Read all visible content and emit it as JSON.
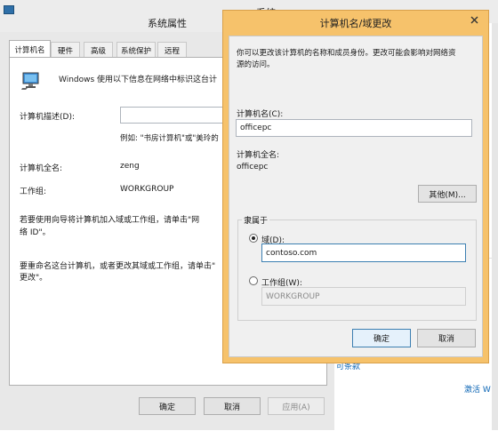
{
  "bg_window": {
    "title": "系统属性",
    "title_fragment": "系统",
    "tabs": [
      {
        "label": "计算机名"
      },
      {
        "label": "硬件"
      },
      {
        "label": "高级"
      },
      {
        "label": "系统保护"
      },
      {
        "label": "远程"
      }
    ],
    "intro": "Windows 使用以下信息在网络中标识这台计",
    "description_label": "计算机描述(D):",
    "description_value": "",
    "example": "例如: \"书房计算机\"或\"美玲的",
    "fullname_label": "计算机全名:",
    "fullname_value": "zeng",
    "workgroup_label": "工作组:",
    "workgroup_value": "WORKGROUP",
    "wizard_text_1": "若要使用向导将计算机加入域或工作组，请单击\"网",
    "wizard_text_2": "络 ID\"。",
    "rename_text_1": "要重命名这台计算机，或者更改其域或工作组，请单击\"",
    "rename_text_2": "更改\"。",
    "ok_button": "确定",
    "cancel_button": "取消",
    "apply_button": "应用(A)"
  },
  "bg_side": {
    "link_text": "可条款",
    "activate_text": "激活 W"
  },
  "dialog": {
    "title": "计算机名/域更改",
    "intro_line1": "你可以更改该计算机的名称和成员身份。更改可能会影响对网络资",
    "intro_line2": "源的访问。",
    "computer_name_label": "计算机名(C):",
    "computer_name_value": "officepc",
    "full_name_label": "计算机全名:",
    "full_name_value": "officepc",
    "other_button": "其他(M)...",
    "member_of_label": "隶属于",
    "domain_radio_label": "域(D):",
    "domain_value": "contoso.com",
    "workgroup_radio_label": "工作组(W):",
    "workgroup_value": "WORKGROUP",
    "ok_button": "确定",
    "cancel_button": "取消"
  },
  "colors": {
    "dialog_frame": "#f6c26b",
    "dialog_body": "#f0f0f0",
    "bg_window_frame": "#ececec",
    "link": "#0a64b4"
  },
  "icons": {
    "computer": "computer-monitor-icon",
    "dialog_close": "close-icon"
  }
}
